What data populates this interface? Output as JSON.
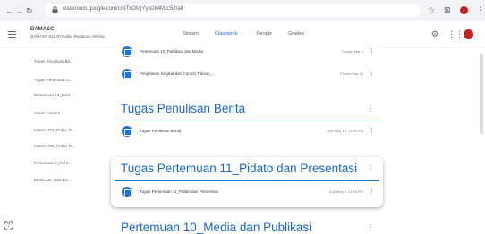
{
  "browser": {
    "url": "classroom.google.com/c/NTkOMjYyNzk4Mzc5/t/all",
    "icons": [
      "back-icon",
      "forward-icon",
      "reload-icon",
      "lock-icon",
      "star-icon",
      "extension-icon",
      "profile-icon",
      "menu-icon"
    ]
  },
  "header": {
    "class_name": "DAMASC",
    "class_subtitle": "DAMASC 811 20 Public Relations Writing",
    "tabs": [
      "Stream",
      "Classwork",
      "People",
      "Grades"
    ],
    "active_tab": "Classwork",
    "accent": "#1967d2"
  },
  "sidebar": {
    "items": [
      "Tugas Penulisan Be...",
      "Tugas Pertemuan 1...",
      "Pertemuan 10_Medi...",
      "Article Feature",
      "Materi UTS_Public R...",
      "Materi UTS_Public R...",
      "Pertemuan 6_Pid 9...",
      "Berita dan Nilai Ber..."
    ]
  },
  "main": {
    "top_items": [
      {
        "title": "Pertemuan 10_Publikasi dan Media",
        "date": "Posted Mar 2"
      },
      {
        "title": "Penjelasan Singkat dan Contoh Tulisan_...",
        "date": "Posted Mar 24"
      }
    ],
    "topics": [
      {
        "title": "Tugas Penulisan Berita",
        "items": [
          {
            "title": "Tugas Penulisan Berita",
            "date": "Due May 16, 11:59 PM"
          }
        ]
      },
      {
        "title": "Tugas Pertemuan 11_Pidato dan Presentasi",
        "items": [
          {
            "title": "Tugas Pertemuan 11_Pidato dan Presentasi",
            "date": "Due May 9, 11:59 PM"
          }
        ]
      },
      {
        "title": "Pertemuan 10_Media dan Publikasi",
        "items": []
      }
    ]
  }
}
